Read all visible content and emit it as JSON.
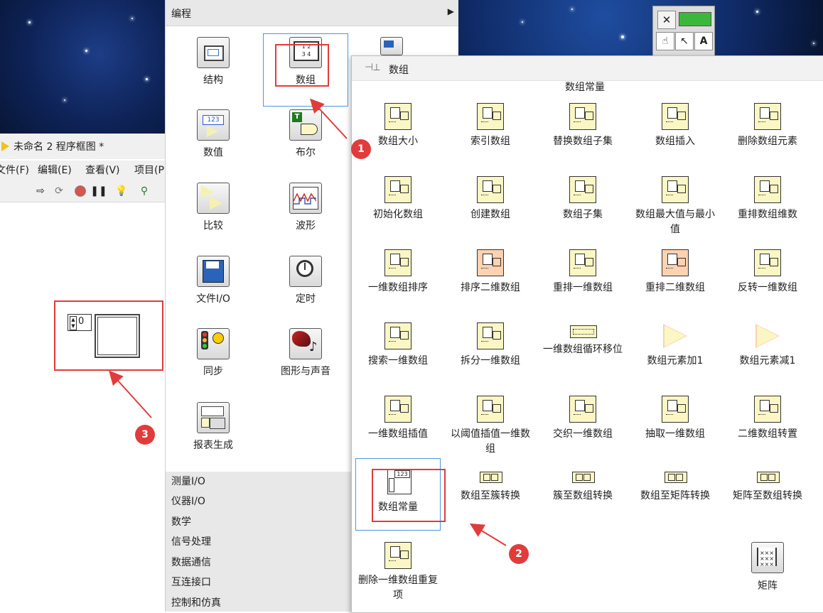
{
  "labview_window": {
    "title": "未命名 2 程序框图 *",
    "menu": [
      "文件(F)",
      "编辑(E)",
      "查看(V)",
      "项目(P"
    ]
  },
  "array_constant_widget": {
    "index_value": "0"
  },
  "programming_palette": {
    "header_title": "编程",
    "items": [
      {
        "label": "结构",
        "icon": "structure-icon"
      },
      {
        "label": "数组",
        "icon": "array-icon"
      },
      {
        "label": "数值",
        "icon": "numeric-icon"
      },
      {
        "label": "布尔",
        "icon": "boolean-icon"
      },
      {
        "label": "比较",
        "icon": "comparison-icon"
      },
      {
        "label": "波形",
        "icon": "waveform-icon"
      },
      {
        "label": "文件I/O",
        "icon": "file-io-icon"
      },
      {
        "label": "定时",
        "icon": "timing-icon"
      },
      {
        "label": "同步",
        "icon": "synchronization-icon"
      },
      {
        "label": "图形与声音",
        "icon": "graphics-sound-icon"
      },
      {
        "label": "报表生成",
        "icon": "report-generation-icon"
      }
    ],
    "categories": [
      "测量I/O",
      "仪器I/O",
      "数学",
      "信号处理",
      "数据通信",
      "互连接口",
      "控制和仿真"
    ]
  },
  "array_palette": {
    "title": "数组",
    "section_label": "数组常量",
    "functions": [
      "数组大小",
      "索引数组",
      "替换数组子集",
      "数组插入",
      "删除数组元素",
      "初始化数组",
      "创建数组",
      "数组子集",
      "数组最大值与最小值",
      "重排数组维数",
      "一维数组排序",
      "排序二维数组",
      "重排一维数组",
      "重排二维数组",
      "反转一维数组",
      "搜索一维数组",
      "拆分一维数组",
      "一维数组循环移位",
      "数组元素加1",
      "数组元素减1",
      "一维数组插值",
      "以阈值插值一维数组",
      "交织一维数组",
      "抽取一维数组",
      "二维数组转置",
      "数组常量",
      "数组至簇转换",
      "簇至数组转换",
      "数组至矩阵转换",
      "矩阵至数组转换",
      "删除一维数组重复项",
      "矩阵"
    ],
    "array_constant_icon_text": "123"
  },
  "annotations": {
    "badges": [
      "1",
      "2",
      "3"
    ],
    "highlight_color": "#e23b3b"
  }
}
